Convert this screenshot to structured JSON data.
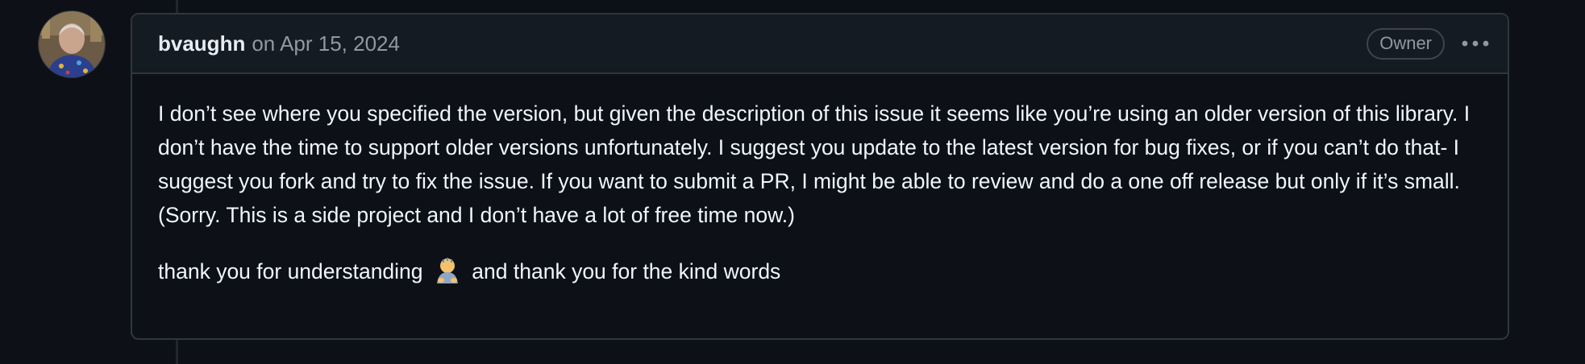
{
  "comment": {
    "author": "bvaughn",
    "on_text": "on",
    "date": "Apr 15, 2024",
    "role_badge": "Owner",
    "menu_icon": "kebab-horizontal-icon",
    "avatar_icon": "user-avatar",
    "body": {
      "paragraph_1": "I don’t see where you specified the version, but given the description of this issue it seems like you’re using an older version of this library. I don’t have the time to support older versions unfortunately. I suggest you update to the latest version for bug fixes, or if you can’t do that- I suggest you fork and try to fix the issue. If you want to submit a PR, I might be able to review and do a one off release but only if it’s small. (Sorry. This is a side project and I don’t have a lot of free time now.)",
      "paragraph_2_before": "thank you for understanding",
      "emoji_icon": "bowing-person-emoji",
      "paragraph_2_after": "and thank you for the kind words"
    }
  },
  "colors": {
    "background": "#0d1117",
    "header_background": "#151b23",
    "border": "#30363d",
    "muted_text": "#9198a1",
    "text": "#f0f6fc"
  }
}
